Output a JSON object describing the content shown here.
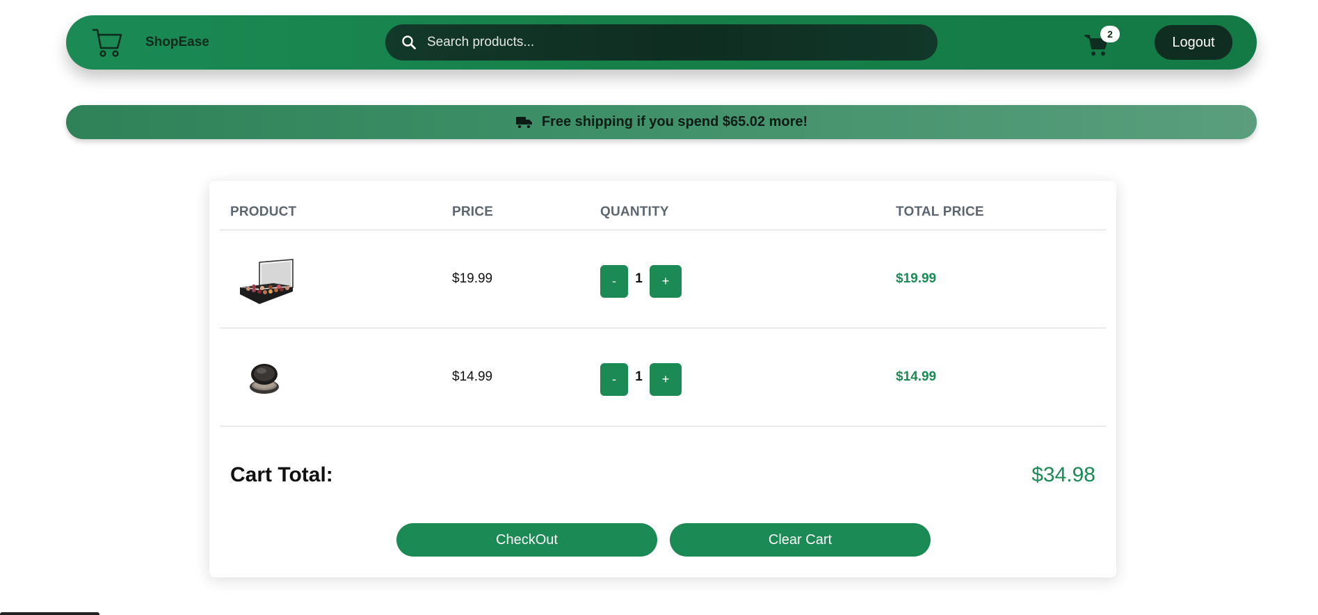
{
  "navbar": {
    "brand_name": "ShopEase",
    "brand_icon": "cart-outline-icon",
    "search_placeholder": "Search products...",
    "search_icon": "magnifier-icon",
    "cart_icon": "cart-icon",
    "cart_count": "2",
    "logout_label": "Logout"
  },
  "banner": {
    "icon": "truck-icon",
    "text": "Free shipping if you spend $65.02 more!"
  },
  "cart": {
    "headers": {
      "product": "PRODUCT",
      "price": "PRICE",
      "quantity": "QUANTITY",
      "total_price": "TOTAL PRICE"
    },
    "items": [
      {
        "image": "eyeshadow-palette-image",
        "price": "$19.99",
        "minus": "-",
        "quantity": "1",
        "plus": "+",
        "total": "$19.99"
      },
      {
        "image": "compact-powder-image",
        "price": "$14.99",
        "minus": "-",
        "quantity": "1",
        "plus": "+",
        "total": "$14.99"
      }
    ],
    "total_label": "Cart Total:",
    "total_value": "$34.98",
    "checkout_label": "CheckOut",
    "clear_label": "Clear Cart"
  },
  "colors": {
    "brand_green": "#1b8a55",
    "dark_green": "#0f2d21",
    "banner_start": "#2f8158",
    "banner_end": "#5a9e7d",
    "header_gray": "#5c6670"
  }
}
